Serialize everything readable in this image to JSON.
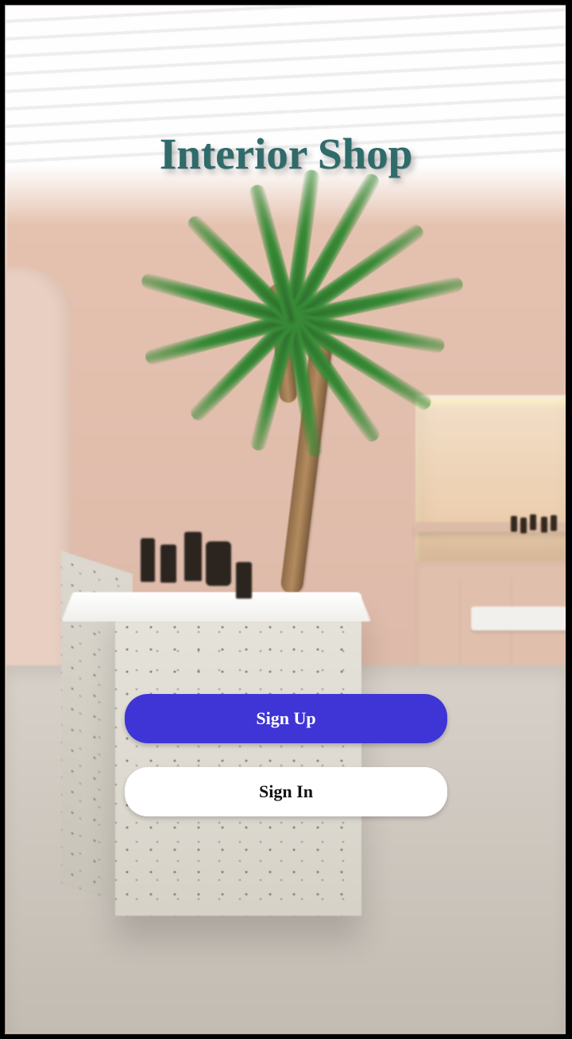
{
  "title": "Interior Shop",
  "buttons": {
    "signup_label": "Sign Up",
    "signin_label": "Sign In"
  },
  "colors": {
    "accent": "#3f34d5",
    "title": "#2f6b6a"
  }
}
